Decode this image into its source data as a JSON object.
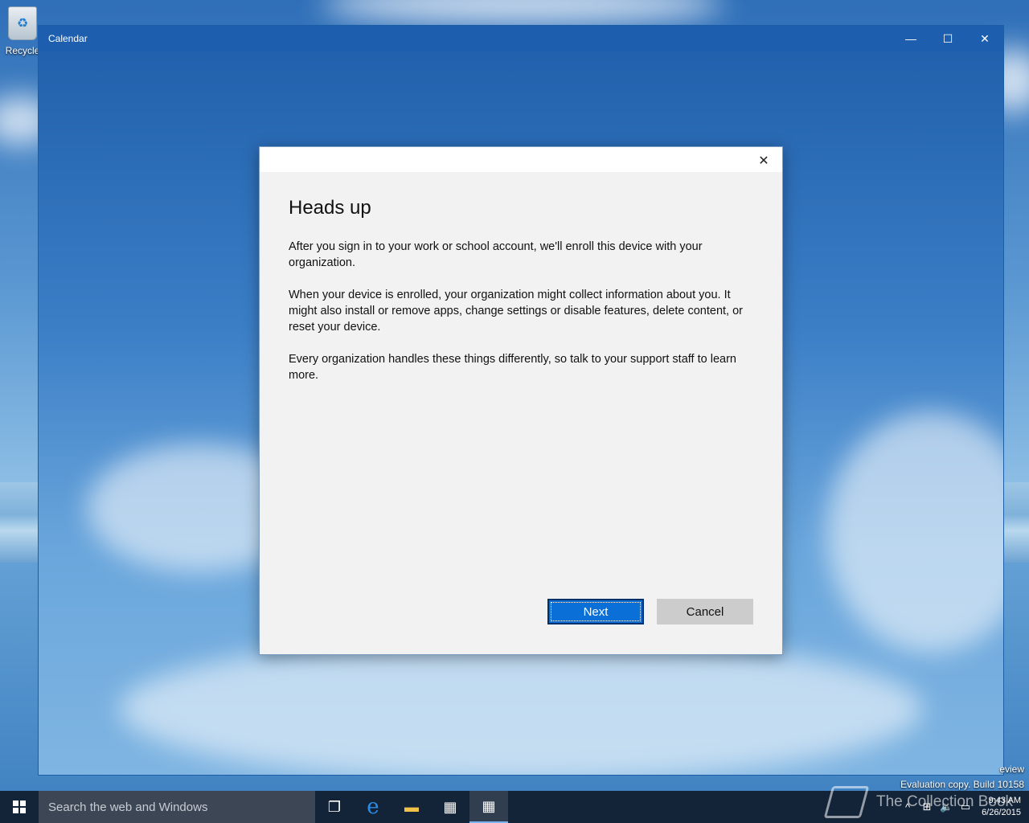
{
  "desktop": {
    "recycle_bin_label": "Recycle",
    "watermark_preview": "eview",
    "watermark_build": "Evaluation copy. Build 10158",
    "brand_text": "The Collection Book"
  },
  "window": {
    "title": "Calendar",
    "minimize_glyph": "—",
    "maximize_glyph": "☐",
    "close_glyph": "✕"
  },
  "dialog": {
    "close_glyph": "✕",
    "heading": "Heads up",
    "paragraphs": [
      "After you sign in to your work or school account, we'll enroll this device with your organization.",
      "When your device is enrolled, your organization might collect information about you. It might also install or remove apps, change settings or disable features, delete content, or reset your device.",
      "Every organization handles these things differently, so talk to your support staff to learn more."
    ],
    "next_label": "Next",
    "cancel_label": "Cancel"
  },
  "taskbar": {
    "search_placeholder": "Search the web and Windows",
    "icons": [
      "task-view-icon",
      "edge-icon",
      "file-explorer-icon",
      "store-icon",
      "calendar-icon"
    ],
    "task_view_glyph": "❐",
    "edge_glyph": "e",
    "explorer_glyph": "▬",
    "store_glyph": "▦",
    "calendar_glyph": "▦",
    "tray_chevron": "^",
    "tray_network": "⊞",
    "tray_volume": "🔈",
    "tray_action": "▭",
    "time": "9:43 AM",
    "date": "6/26/2015"
  },
  "colors": {
    "accent": "#0a6fd6",
    "titlebar": "#1d5fae",
    "dialog_bg": "#f2f2f2"
  }
}
